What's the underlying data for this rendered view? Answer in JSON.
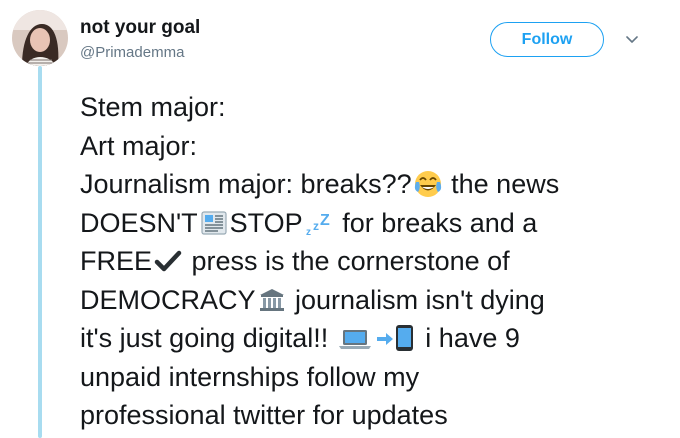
{
  "user": {
    "display_name": "not your goal",
    "handle": "@Primademma"
  },
  "actions": {
    "follow_label": "Follow",
    "menu_icon": "chevron-down-icon"
  },
  "tweet": {
    "line1": "Stem major:",
    "line2": "Art major:",
    "line3a": "Journalism major: breaks??",
    "line3b": " the news",
    "line4a": "DOESN'T",
    "line4b": "STOP",
    "line4c": " for breaks and a",
    "line5a": "FREE",
    "line5b": " press is the cornerstone of",
    "line6a": "DEMOCRACY",
    "line6b": " journalism isn't dying",
    "line7a": "it's just going digital!! ",
    "line7b": " i have 9",
    "line8": "unpaid internships follow my",
    "line9": "professional twitter for updates"
  },
  "emojis": [
    "tears-of-joy-emoji",
    "newspaper-emoji",
    "zzz-emoji",
    "check-mark-emoji",
    "classical-building-emoji",
    "laptop-emoji",
    "mobile-arrow-emoji"
  ],
  "colors": {
    "accent": "#1da1f2",
    "thread_line": "#a8dcf0",
    "text": "#14171a",
    "muted": "#657786"
  }
}
